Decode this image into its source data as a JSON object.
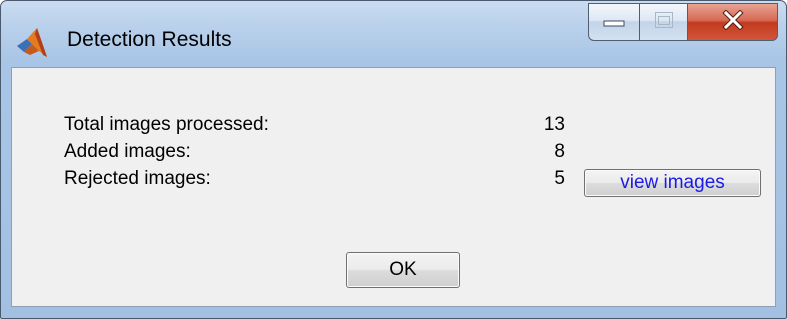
{
  "window": {
    "title": "Detection Results",
    "icon": "matlab-icon",
    "controls": {
      "minimize": "minimize-icon",
      "maximize": "maximize-icon",
      "close": "close-icon"
    }
  },
  "stats": [
    {
      "label": "Total images processed:",
      "value": "13"
    },
    {
      "label": "Added images:",
      "value": "8"
    },
    {
      "label": "Rejected images:",
      "value": "5"
    }
  ],
  "buttons": {
    "view_images_label": "view images",
    "ok_label": "OK"
  },
  "colors": {
    "link_text": "#1a1ae6",
    "close_button": "#c8452a",
    "client_background": "#f0f0f0"
  }
}
